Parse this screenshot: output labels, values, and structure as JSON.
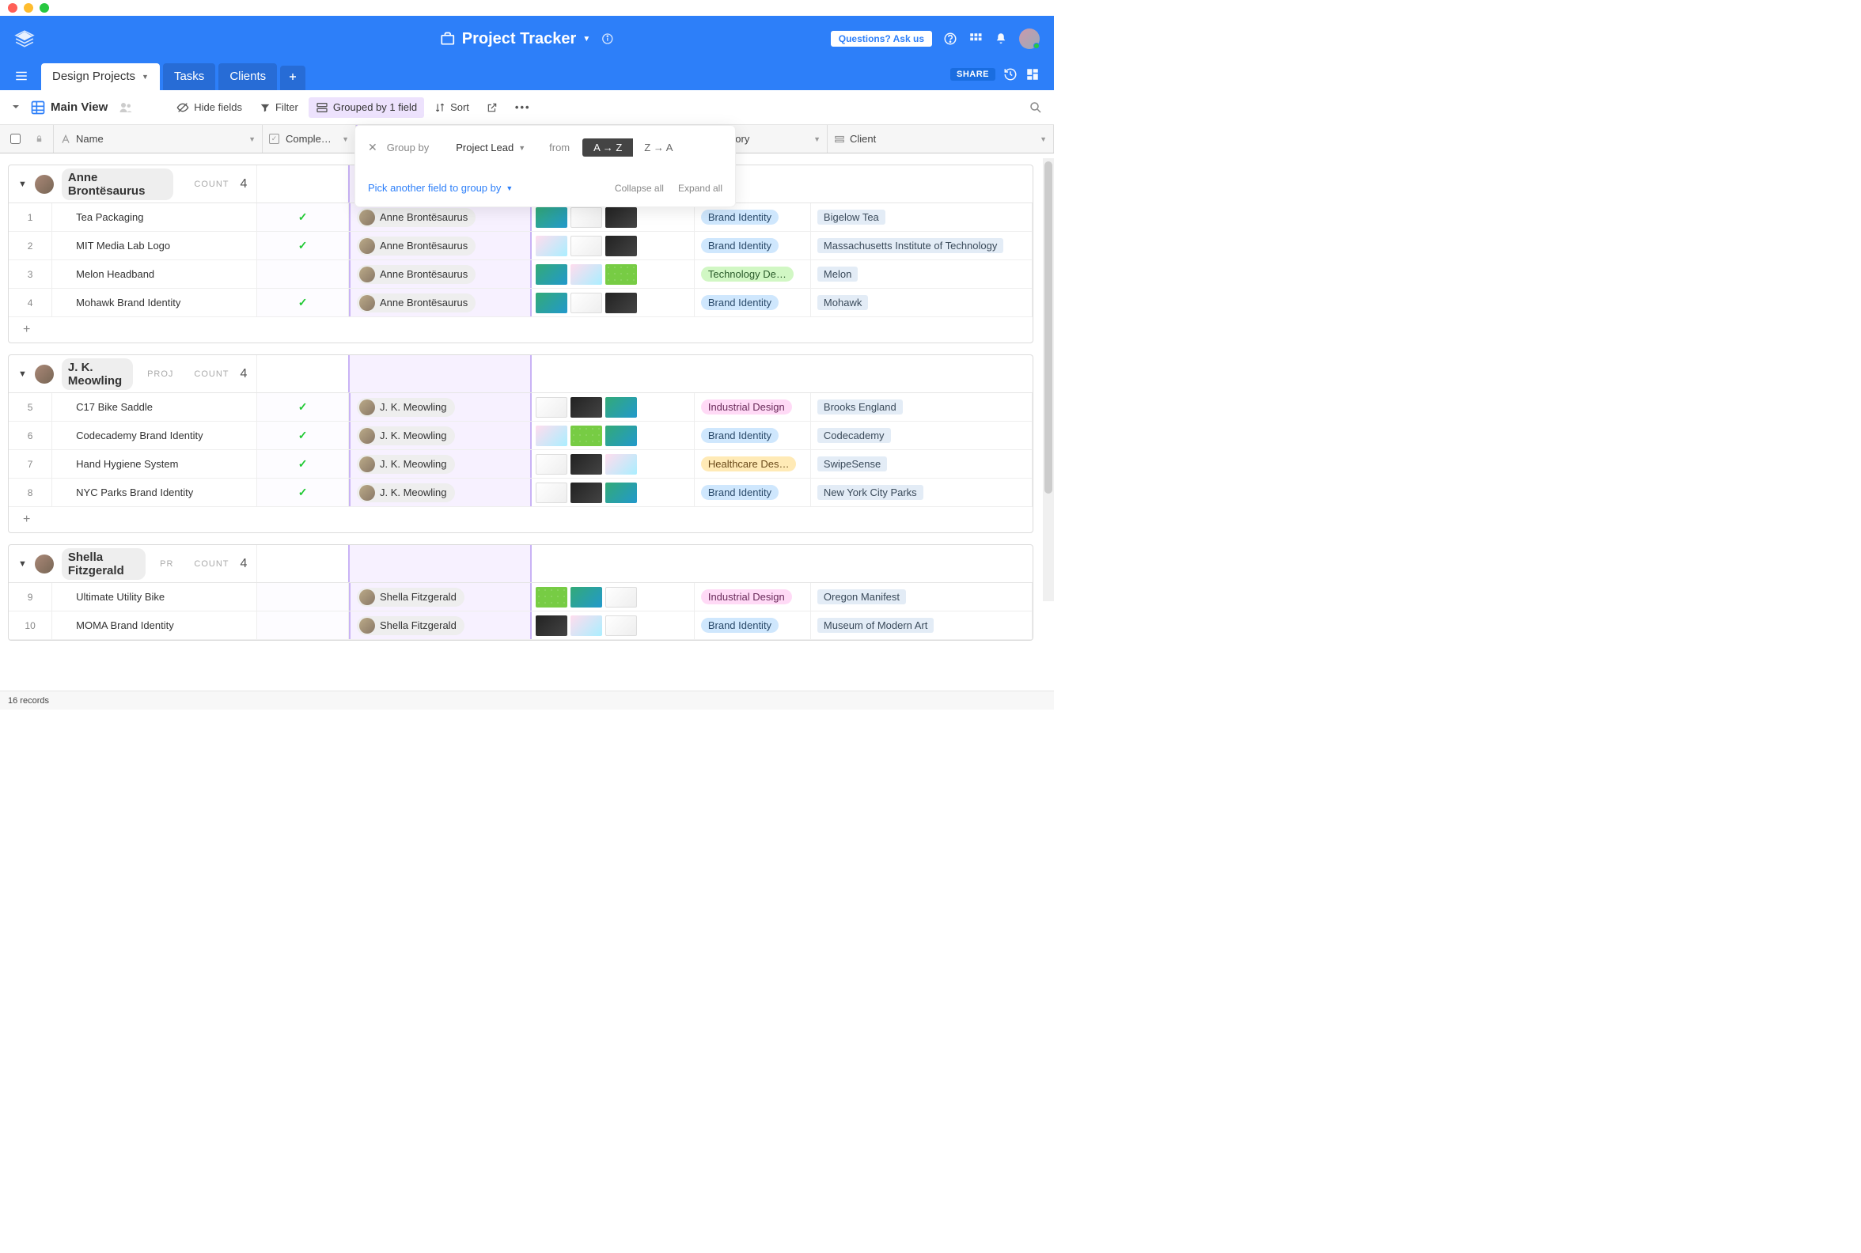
{
  "window": {
    "title": "Project Tracker"
  },
  "header": {
    "questions_btn": "Questions? Ask us",
    "share_btn": "SHARE"
  },
  "tabs": [
    {
      "label": "Design Projects",
      "active": true
    },
    {
      "label": "Tasks",
      "active": false
    },
    {
      "label": "Clients",
      "active": false
    }
  ],
  "view": {
    "name": "Main View"
  },
  "toolbar": {
    "hide_fields": "Hide fields",
    "filter": "Filter",
    "grouped": "Grouped by 1 field",
    "sort": "Sort"
  },
  "group_popover": {
    "group_by_label": "Group by",
    "field": "Project Lead",
    "from_label": "from",
    "sort_asc": "A → Z",
    "sort_desc": "Z → A",
    "pick_another": "Pick another field to group by",
    "collapse_all": "Collapse all",
    "expand_all": "Expand all"
  },
  "columns": {
    "name": "Name",
    "complete": "Comple…",
    "lead_partial": "…",
    "category_partial": "ategory",
    "client": "Client"
  },
  "groups": [
    {
      "lead": "Anne Brontësaurus",
      "count_label": "COUNT",
      "count": 4,
      "proj_label": "",
      "rows": [
        {
          "num": 1,
          "name": "Tea Packaging",
          "complete": true,
          "lead": "Anne Brontësaurus",
          "category": "Brand Identity",
          "cat_color": "blue",
          "client": "Bigelow Tea"
        },
        {
          "num": 2,
          "name": "MIT Media Lab Logo",
          "complete": true,
          "lead": "Anne Brontësaurus",
          "category": "Brand Identity",
          "cat_color": "blue",
          "client": "Massachusetts Institute of Technology"
        },
        {
          "num": 3,
          "name": "Melon Headband",
          "complete": false,
          "lead": "Anne Brontësaurus",
          "category": "Technology De…",
          "cat_color": "green",
          "client": "Melon"
        },
        {
          "num": 4,
          "name": "Mohawk Brand Identity",
          "complete": true,
          "lead": "Anne Brontësaurus",
          "category": "Brand Identity",
          "cat_color": "blue",
          "client": "Mohawk"
        }
      ]
    },
    {
      "lead": "J. K. Meowling",
      "count_label": "COUNT",
      "count": 4,
      "proj_label": "PROJ",
      "rows": [
        {
          "num": 5,
          "name": "C17 Bike Saddle",
          "complete": true,
          "lead": "J. K. Meowling",
          "category": "Industrial Design",
          "cat_color": "pink",
          "client": "Brooks England"
        },
        {
          "num": 6,
          "name": "Codecademy Brand Identity",
          "complete": true,
          "lead": "J. K. Meowling",
          "category": "Brand Identity",
          "cat_color": "blue",
          "client": "Codecademy"
        },
        {
          "num": 7,
          "name": "Hand Hygiene System",
          "complete": true,
          "lead": "J. K. Meowling",
          "category": "Healthcare Des…",
          "cat_color": "orange",
          "client": "SwipeSense"
        },
        {
          "num": 8,
          "name": "NYC Parks Brand Identity",
          "complete": true,
          "lead": "J. K. Meowling",
          "category": "Brand Identity",
          "cat_color": "blue",
          "client": "New York City Parks"
        }
      ]
    },
    {
      "lead": "Shella Fitzgerald",
      "count_label": "COUNT",
      "count": 4,
      "proj_label": "PR",
      "rows": [
        {
          "num": 9,
          "name": "Ultimate Utility Bike",
          "complete": false,
          "lead": "Shella Fitzgerald",
          "category": "Industrial Design",
          "cat_color": "pink",
          "client": "Oregon Manifest"
        },
        {
          "num": 10,
          "name": "MOMA Brand Identity",
          "complete": false,
          "lead": "Shella Fitzgerald",
          "category": "Brand Identity",
          "cat_color": "blue",
          "client": "Museum of Modern Art"
        }
      ]
    }
  ],
  "footer": {
    "records": "16 records"
  }
}
